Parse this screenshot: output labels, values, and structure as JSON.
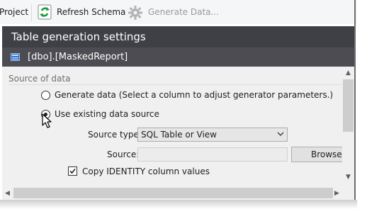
{
  "toolbar": {
    "project_label": "Project",
    "refresh_schema_label": "Refresh Schema",
    "generate_data_label": "Generate Data...",
    "refresh_icon": "refresh-icon",
    "generate_icon": "gear-icon"
  },
  "settings": {
    "title": "Table generation settings",
    "object_name": "[dbo].[MaskedReport]",
    "object_icon": "table-icon"
  },
  "source_of_data": {
    "group_label": "Source of data",
    "options": [
      {
        "label": "Generate data (Select a column to adjust generator parameters.)",
        "checked": false
      },
      {
        "label": "Use existing data source",
        "checked": true
      }
    ],
    "source_type_label": "Source type:",
    "source_type_value": "SQL Table or View",
    "source_label": "Source:",
    "source_value": "",
    "browse_label": "Browse...",
    "copy_identity_label": "Copy IDENTITY column values",
    "copy_identity_checked": true
  },
  "colors": {
    "header_bg": "#3f3f46",
    "object_row_bg": "#4c4c52",
    "panel_bg": "#f0f0f0",
    "accent_green": "#1a9a3a"
  }
}
